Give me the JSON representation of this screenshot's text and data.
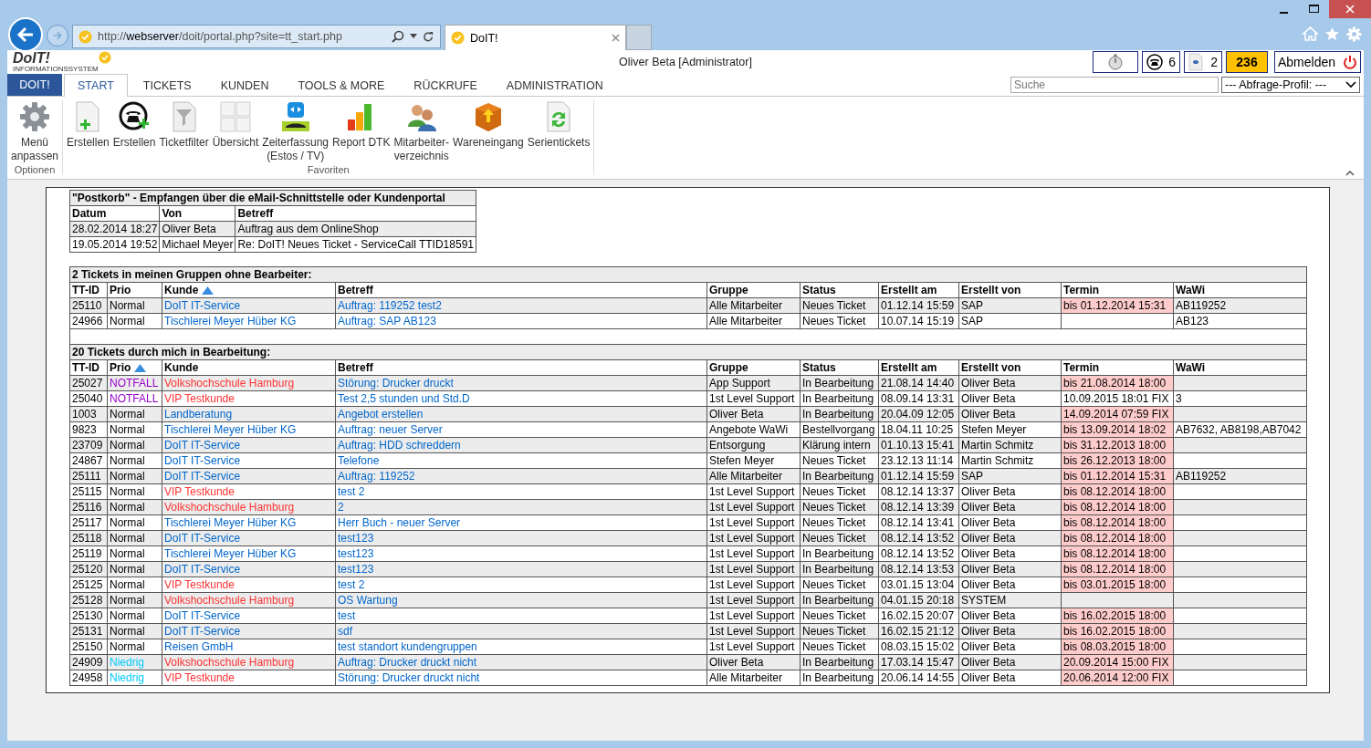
{
  "browser": {
    "address": {
      "prefix": "http://",
      "host": "webserver",
      "path": "/doit/portal.php?site=tt_start.php"
    },
    "tab_title": "DoIT!"
  },
  "header": {
    "logo": "DoIT!",
    "logo_subtitle": "INFORMATIONSSYSTEM",
    "user": "Oliver Beta [Administrator]",
    "phone_count": "6",
    "document_count": "2",
    "badge_count": "236",
    "logout": "Abmelden"
  },
  "menu": {
    "app_button": "DOIT!",
    "tabs": [
      {
        "label": "START",
        "selected": true
      },
      {
        "label": "TICKETS",
        "selected": false
      },
      {
        "label": "KUNDEN",
        "selected": false
      },
      {
        "label": "TOOLS & MORE",
        "selected": false
      },
      {
        "label": "RÜCKRUFE",
        "selected": false
      },
      {
        "label": "ADMINISTRATION",
        "selected": false
      }
    ],
    "search": {
      "placeholder": "Suche"
    },
    "profile_select": "--- Abfrage-Profil: ---"
  },
  "ribbon": {
    "groups": [
      {
        "label": "Optionen",
        "items": [
          {
            "label": "Menü\nanpassen"
          }
        ]
      },
      {
        "label": "Favoriten",
        "items": [
          {
            "label": "Erstellen"
          },
          {
            "label": "Erstellen"
          },
          {
            "label": "Ticketfilter"
          },
          {
            "label": "Übersicht"
          },
          {
            "label": "Zeiterfassung\n(Estos / TV)"
          },
          {
            "label": "Report DTK"
          },
          {
            "label": "Mitarbeiter-\nverzeichnis"
          },
          {
            "label": "Wareneingang"
          },
          {
            "label": "Serientickets"
          }
        ]
      }
    ]
  },
  "postkorb": {
    "title": "\"Postkorb\" - Empfangen über die eMail-Schnittstelle oder Kundenportal",
    "columns": [
      "Datum",
      "Von",
      "Betreff"
    ],
    "rows": [
      [
        "28.02.2014 18:27",
        "Oliver Beta",
        "Auftrag aus dem OnlineShop"
      ],
      [
        "19.05.2014 19:52",
        "Michael Meyer",
        "Re: DoIT! Neues Ticket - ServiceCall TTID18591"
      ]
    ]
  },
  "ticket_sections": [
    {
      "title": "2 Tickets in meinen Gruppen ohne Bearbeiter:",
      "columns": [
        {
          "label": "TT-ID",
          "sorted": false
        },
        {
          "label": "Prio",
          "sorted": false
        },
        {
          "label": "Kunde",
          "sorted": true
        },
        {
          "label": "Betreff",
          "sorted": false
        },
        {
          "label": "Gruppe",
          "sorted": false
        },
        {
          "label": "Status",
          "sorted": false
        },
        {
          "label": "Erstellt am",
          "sorted": false
        },
        {
          "label": "Erstellt von",
          "sorted": false
        },
        {
          "label": "Termin",
          "sorted": false
        },
        {
          "label": "WaWi",
          "sorted": false
        }
      ],
      "rows": [
        {
          "id": "25110",
          "prio": {
            "text": "Normal",
            "color": "#000000"
          },
          "kunde": {
            "text": "DoIT IT-Service",
            "color": "#0066cc"
          },
          "betreff": "Auftrag: 119252 test2",
          "gruppe": "Alle Mitarbeiter",
          "status": "Neues Ticket",
          "erstellt_am": "01.12.14 15:59",
          "erstellt_von": "SAP",
          "termin": "bis 01.12.2014 15:31",
          "overdue": true,
          "wawi": "AB119252"
        },
        {
          "id": "24966",
          "prio": {
            "text": "Normal",
            "color": "#000000"
          },
          "kunde": {
            "text": "Tischlerei Meyer Hüber KG",
            "color": "#0066cc"
          },
          "betreff": "Auftrag: SAP AB123",
          "gruppe": "Alle Mitarbeiter",
          "status": "Neues Ticket",
          "erstellt_am": "10.07.14 15:19",
          "erstellt_von": "SAP",
          "overdue": false,
          "wawi": "AB123"
        }
      ]
    },
    {
      "title": "20 Tickets durch mich in Bearbeitung:",
      "columns": [
        {
          "label": "TT-ID",
          "sorted": false
        },
        {
          "label": "Prio",
          "sorted": true
        },
        {
          "label": "Kunde",
          "sorted": false
        },
        {
          "label": "Betreff",
          "sorted": false
        },
        {
          "label": "Gruppe",
          "sorted": false
        },
        {
          "label": "Status",
          "sorted": false
        },
        {
          "label": "Erstellt am",
          "sorted": false
        },
        {
          "label": "Erstellt von",
          "sorted": false
        },
        {
          "label": "Termin",
          "sorted": false
        },
        {
          "label": "WaWi",
          "sorted": false
        }
      ],
      "rows": [
        {
          "id": "25027",
          "prio": {
            "text": "NOTFALL",
            "color": "#9900cc"
          },
          "kunde": {
            "text": "Volkshochschule Hamburg",
            "color": "#ff3333"
          },
          "betreff": "Störung: Drucker druckt",
          "gruppe": "App Support",
          "status": "In Bearbeitung",
          "erstellt_am": "21.08.14 14:40",
          "erstellt_von": "Oliver Beta",
          "termin": "bis 21.08.2014 18:00",
          "overdue": true
        },
        {
          "id": "25040",
          "prio": {
            "text": "NOTFALL",
            "color": "#9900cc"
          },
          "kunde": {
            "text": "VIP Testkunde",
            "color": "#ff3333"
          },
          "betreff": "Test 2,5 stunden und Std.D",
          "gruppe": "1st Level Support",
          "status": "In Bearbeitung",
          "erstellt_am": "08.09.14 13:31",
          "erstellt_von": "Oliver Beta",
          "termin": "10.09.2015 18:01 FIX",
          "overdue": false,
          "wawi": "3"
        },
        {
          "id": "1003",
          "prio": {
            "text": "Normal",
            "color": "#000000"
          },
          "kunde": {
            "text": "Landberatung",
            "color": "#0066cc"
          },
          "betreff": "Angebot erstellen",
          "gruppe": "Oliver Beta",
          "status": "In Bearbeitung",
          "erstellt_am": "20.04.09 12:05",
          "erstellt_von": "Oliver Beta",
          "termin": "14.09.2014 07:59 FIX",
          "overdue": true
        },
        {
          "id": "9823",
          "prio": {
            "text": "Normal",
            "color": "#000000"
          },
          "kunde": {
            "text": "Tischlerei Meyer Hüber KG",
            "color": "#0066cc"
          },
          "betreff": "Auftrag: neuer Server",
          "gruppe": "Angebote WaWi",
          "status": "Bestellvorgang",
          "erstellt_am": "18.04.11 10:25",
          "erstellt_von": "Stefen Meyer",
          "termin": "bis 13.09.2014 18:02",
          "overdue": true,
          "wawi": "AB7632, AB8198,AB7042"
        },
        {
          "id": "23709",
          "prio": {
            "text": "Normal",
            "color": "#000000"
          },
          "kunde": {
            "text": "DoIT IT-Service",
            "color": "#0066cc"
          },
          "betreff": "Auftrag: HDD schreddern",
          "gruppe": "Entsorgung",
          "status": "Klärung intern",
          "erstellt_am": "01.10.13 15:41",
          "erstellt_von": "Martin Schmitz",
          "termin": "bis 31.12.2013 18:00",
          "overdue": true
        },
        {
          "id": "24867",
          "prio": {
            "text": "Normal",
            "color": "#000000"
          },
          "kunde": {
            "text": "DoIT IT-Service",
            "color": "#0066cc"
          },
          "betreff": "Telefone",
          "gruppe": "Stefen Meyer",
          "status": "Neues Ticket",
          "erstellt_am": "23.12.13 11:14",
          "erstellt_von": "Martin Schmitz",
          "termin": "bis 26.12.2013 18:00",
          "overdue": true
        },
        {
          "id": "25111",
          "prio": {
            "text": "Normal",
            "color": "#000000"
          },
          "kunde": {
            "text": "DoIT IT-Service",
            "color": "#0066cc"
          },
          "betreff": "Auftrag: 119252",
          "gruppe": "Alle Mitarbeiter",
          "status": "In Bearbeitung",
          "erstellt_am": "01.12.14 15:59",
          "erstellt_von": "SAP",
          "termin": "bis 01.12.2014 15:31",
          "overdue": true,
          "wawi": "AB119252"
        },
        {
          "id": "25115",
          "prio": {
            "text": "Normal",
            "color": "#000000"
          },
          "kunde": {
            "text": "VIP Testkunde",
            "color": "#ff3333"
          },
          "betreff": "test 2",
          "gruppe": "1st Level Support",
          "status": "Neues Ticket",
          "erstellt_am": "08.12.14 13:37",
          "erstellt_von": "Oliver Beta",
          "termin": "bis 08.12.2014 18:00",
          "overdue": true
        },
        {
          "id": "25116",
          "prio": {
            "text": "Normal",
            "color": "#000000"
          },
          "kunde": {
            "text": "Volkshochschule Hamburg",
            "color": "#ff3333"
          },
          "betreff": "2",
          "gruppe": "1st Level Support",
          "status": "Neues Ticket",
          "erstellt_am": "08.12.14 13:39",
          "erstellt_von": "Oliver Beta",
          "termin": "bis 08.12.2014 18:00",
          "overdue": true
        },
        {
          "id": "25117",
          "prio": {
            "text": "Normal",
            "color": "#000000"
          },
          "kunde": {
            "text": "Tischlerei Meyer Hüber KG",
            "color": "#0066cc"
          },
          "betreff": "Herr Buch - neuer Server",
          "gruppe": "1st Level Support",
          "status": "Neues Ticket",
          "erstellt_am": "08.12.14 13:41",
          "erstellt_von": "Oliver Beta",
          "termin": "bis 08.12.2014 18:00",
          "overdue": true
        },
        {
          "id": "25118",
          "prio": {
            "text": "Normal",
            "color": "#000000"
          },
          "kunde": {
            "text": "DoIT IT-Service",
            "color": "#0066cc"
          },
          "betreff": "test123",
          "gruppe": "1st Level Support",
          "status": "Neues Ticket",
          "erstellt_am": "08.12.14 13:52",
          "erstellt_von": "Oliver Beta",
          "termin": "bis 08.12.2014 18:00",
          "overdue": true
        },
        {
          "id": "25119",
          "prio": {
            "text": "Normal",
            "color": "#000000"
          },
          "kunde": {
            "text": "Tischlerei Meyer Hüber KG",
            "color": "#0066cc"
          },
          "betreff": "test123",
          "gruppe": "1st Level Support",
          "status": "In Bearbeitung",
          "erstellt_am": "08.12.14 13:52",
          "erstellt_von": "Oliver Beta",
          "termin": "bis 08.12.2014 18:00",
          "overdue": true
        },
        {
          "id": "25120",
          "prio": {
            "text": "Normal",
            "color": "#000000"
          },
          "kunde": {
            "text": "DoIT IT-Service",
            "color": "#0066cc"
          },
          "betreff": "test123",
          "gruppe": "1st Level Support",
          "status": "In Bearbeitung",
          "erstellt_am": "08.12.14 13:53",
          "erstellt_von": "Oliver Beta",
          "termin": "bis 08.12.2014 18:00",
          "overdue": true
        },
        {
          "id": "25125",
          "prio": {
            "text": "Normal",
            "color": "#000000"
          },
          "kunde": {
            "text": "VIP Testkunde",
            "color": "#ff3333"
          },
          "betreff": "test 2",
          "gruppe": "1st Level Support",
          "status": "Neues Ticket",
          "erstellt_am": "03.01.15 13:04",
          "erstellt_von": "Oliver Beta",
          "termin": "bis 03.01.2015 18:00",
          "overdue": true
        },
        {
          "id": "25128",
          "prio": {
            "text": "Normal",
            "color": "#000000"
          },
          "kunde": {
            "text": "Volkshochschule Hamburg",
            "color": "#ff3333"
          },
          "betreff": "OS Wartung",
          "gruppe": "1st Level Support",
          "status": "In Bearbeitung",
          "erstellt_am": "04.01.15 20:18",
          "erstellt_von": "SYSTEM",
          "overdue": false
        },
        {
          "id": "25130",
          "prio": {
            "text": "Normal",
            "color": "#000000"
          },
          "kunde": {
            "text": "DoIT IT-Service",
            "color": "#0066cc"
          },
          "betreff": "test",
          "gruppe": "1st Level Support",
          "status": "Neues Ticket",
          "erstellt_am": "16.02.15 20:07",
          "erstellt_von": "Oliver Beta",
          "termin": "bis 16.02.2015 18:00",
          "overdue": true
        },
        {
          "id": "25131",
          "prio": {
            "text": "Normal",
            "color": "#000000"
          },
          "kunde": {
            "text": "DoIT IT-Service",
            "color": "#0066cc"
          },
          "betreff": "sdf",
          "gruppe": "1st Level Support",
          "status": "Neues Ticket",
          "erstellt_am": "16.02.15 21:12",
          "erstellt_von": "Oliver Beta",
          "termin": "bis 16.02.2015 18:00",
          "overdue": true
        },
        {
          "id": "25150",
          "prio": {
            "text": "Normal",
            "color": "#000000"
          },
          "kunde": {
            "text": "Reisen GmbH",
            "color": "#0066cc"
          },
          "betreff": "test standort kundengruppen",
          "gruppe": "1st Level Support",
          "status": "Neues Ticket",
          "erstellt_am": "08.03.15 15:02",
          "erstellt_von": "Oliver Beta",
          "termin": "bis 08.03.2015 18:00",
          "overdue": true
        },
        {
          "id": "24909",
          "prio": {
            "text": "Niedrig",
            "color": "#00ccff"
          },
          "kunde": {
            "text": "Volkshochschule Hamburg",
            "color": "#ff3333"
          },
          "betreff": "Auftrag: Drucker druckt nicht",
          "gruppe": "Oliver Beta",
          "status": "In Bearbeitung",
          "erstellt_am": "17.03.14 15:47",
          "erstellt_von": "Oliver Beta",
          "termin": "20.09.2014 15:00 FIX",
          "overdue": true
        },
        {
          "id": "24958",
          "prio": {
            "text": "Niedrig",
            "color": "#00ccff"
          },
          "kunde": {
            "text": "VIP Testkunde",
            "color": "#ff3333"
          },
          "betreff": "Störung: Drucker druckt nicht",
          "gruppe": "Alle Mitarbeiter",
          "status": "In Bearbeitung",
          "erstellt_am": "20.06.14 14:55",
          "erstellt_von": "Oliver Beta",
          "termin": "20.06.2014 12:00 FIX",
          "overdue": true
        }
      ]
    }
  ]
}
